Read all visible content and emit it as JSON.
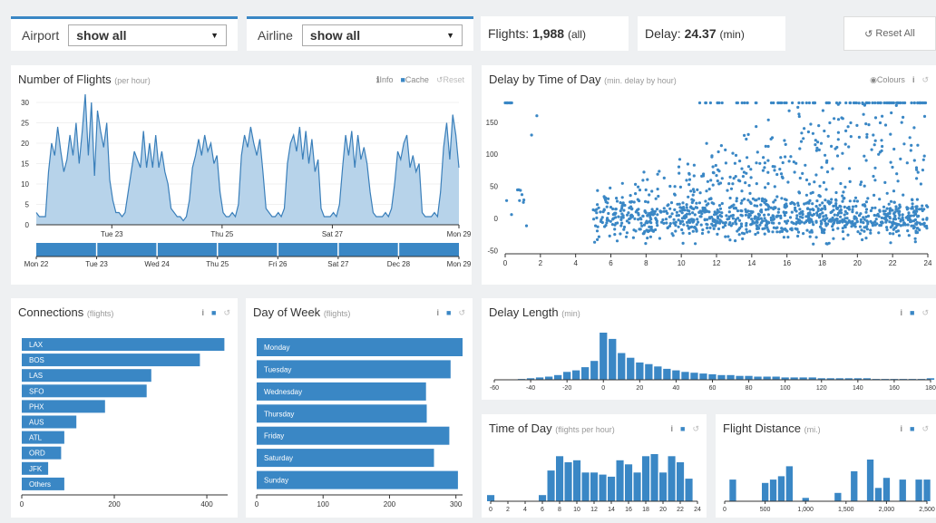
{
  "filters": {
    "airport": {
      "label": "Airport",
      "value": "show all"
    },
    "airline": {
      "label": "Airline",
      "value": "show all"
    }
  },
  "stats": {
    "flights_label": "Flights:",
    "flights_value": "1,988",
    "flights_unit": "(all)",
    "delay_label": "Delay:",
    "delay_value": "24.37",
    "delay_unit": "(min)",
    "reset_all": "Reset All"
  },
  "tools": {
    "info": "Info",
    "cache": "Cache",
    "reset": "Reset",
    "colours": "Colours",
    "i": "i"
  },
  "icons": {
    "info": "info-icon",
    "bookmark": "bookmark-icon",
    "reset": "reset-icon",
    "eye": "eye-icon",
    "caret": "caret-down-icon"
  },
  "colors": {
    "bar": "#3a87c5",
    "area_fill": "#b7d3ea",
    "line": "#3a7fba",
    "accent": "#3a87c5",
    "background": "#eef0f2"
  },
  "panels": {
    "flights_per_hour": {
      "title": "Number of Flights",
      "subtitle": "(per hour)"
    },
    "delay_by_time": {
      "title": "Delay by Time of Day",
      "subtitle": "(min. delay by hour)"
    },
    "connections": {
      "title": "Connections",
      "subtitle": "(flights)"
    },
    "day_of_week": {
      "title": "Day of Week",
      "subtitle": "(flights)"
    },
    "delay_length": {
      "title": "Delay Length",
      "subtitle": "(min)"
    },
    "time_of_day": {
      "title": "Time of Day",
      "subtitle": "(flights per hour)"
    },
    "distance": {
      "title": "Flight Distance",
      "subtitle": "(mi.)"
    }
  },
  "chart_data": [
    {
      "id": "flights_per_hour",
      "type": "area",
      "x": [
        0,
        3,
        6,
        9,
        12,
        15,
        18,
        21,
        24,
        27,
        30,
        33,
        36,
        39,
        42,
        45,
        48,
        51,
        54,
        57,
        60,
        63,
        66,
        69,
        72,
        75,
        78,
        81,
        84,
        87,
        90,
        93,
        96,
        99,
        102,
        105,
        108,
        111,
        114,
        117,
        120,
        123,
        126,
        129,
        132,
        135,
        138,
        141,
        144,
        147,
        150,
        153,
        156,
        159,
        162,
        165,
        168,
        171,
        174,
        177,
        180,
        183,
        186,
        189,
        192,
        195,
        198,
        201,
        204,
        207,
        210,
        213,
        216,
        219,
        222,
        225,
        228,
        231,
        234,
        237,
        240,
        243,
        246,
        249,
        252,
        255,
        258,
        261,
        264,
        267,
        270,
        273,
        276,
        279,
        282,
        285,
        288,
        291,
        294,
        297,
        300,
        303,
        306,
        309,
        312,
        315,
        318,
        321,
        324,
        327,
        330,
        333,
        336,
        339,
        342,
        345,
        348,
        351,
        354,
        357,
        360,
        363,
        366,
        369,
        372,
        375,
        378,
        381,
        384,
        387,
        390,
        393,
        396,
        399,
        402,
        405,
        408,
        411,
        414
      ],
      "values": [
        3,
        2,
        2,
        2,
        13,
        20,
        17,
        24,
        18,
        13,
        16,
        22,
        17,
        25,
        15,
        23,
        32,
        17,
        30,
        12,
        28,
        23,
        19,
        25,
        11,
        6,
        3,
        3,
        2,
        3,
        8,
        13,
        18,
        16,
        14,
        23,
        14,
        20,
        14,
        22,
        14,
        18,
        13,
        10,
        4,
        3,
        2,
        2,
        1,
        2,
        6,
        14,
        17,
        21,
        17,
        22,
        18,
        20,
        15,
        17,
        8,
        3,
        2,
        2,
        3,
        2,
        5,
        17,
        22,
        19,
        24,
        20,
        17,
        21,
        13,
        4,
        3,
        2,
        2,
        3,
        2,
        4,
        15,
        20,
        22,
        18,
        24,
        16,
        23,
        15,
        21,
        13,
        16,
        4,
        2,
        2,
        2,
        3,
        2,
        5,
        14,
        22,
        17,
        23,
        14,
        22,
        16,
        19,
        15,
        8,
        3,
        2,
        2,
        2,
        3,
        2,
        4,
        10,
        18,
        16,
        20,
        22,
        14,
        17,
        13,
        15,
        3,
        2,
        2,
        2,
        3,
        2,
        8,
        19,
        25,
        16,
        27,
        22,
        14,
        20
      ],
      "ylim": [
        0,
        32
      ],
      "yticks": [
        0,
        5,
        10,
        15,
        20,
        25,
        30
      ],
      "xticks": [
        {
          "x": 74,
          "label": "Tue 23"
        },
        {
          "x": 182,
          "label": "Thu 25"
        },
        {
          "x": 290,
          "label": "Sat 27"
        },
        {
          "x": 414,
          "label": "Mon 29"
        }
      ],
      "brush_ticks": [
        "Mon 22",
        "Tue 23",
        "Wed 24",
        "Thu 25",
        "Fri 26",
        "Sat 27",
        "Dec 28",
        "Mon 29"
      ]
    },
    {
      "id": "delay_by_time",
      "type": "scatter",
      "xlim": [
        0,
        24
      ],
      "ylim": [
        -55,
        185
      ],
      "xticks": [
        0,
        2,
        4,
        6,
        8,
        10,
        12,
        14,
        16,
        18,
        20,
        22,
        24
      ],
      "yticks": [
        -50,
        0,
        50,
        100,
        150
      ],
      "points": []
    },
    {
      "id": "connections",
      "type": "bar",
      "orientation": "horizontal",
      "categories": [
        "LAX",
        "BOS",
        "LAS",
        "SFO",
        "PHX",
        "AUS",
        "ATL",
        "ORD",
        "JFK",
        "Others"
      ],
      "values": [
        438,
        385,
        280,
        270,
        180,
        118,
        92,
        85,
        57,
        92
      ],
      "xlim": [
        0,
        445
      ],
      "xticks": [
        0,
        200,
        400
      ]
    },
    {
      "id": "day_of_week",
      "type": "bar",
      "orientation": "horizontal",
      "categories": [
        "Monday",
        "Tuesday",
        "Wednesday",
        "Thursday",
        "Friday",
        "Saturday",
        "Sunday"
      ],
      "values": [
        310,
        292,
        255,
        256,
        290,
        267,
        303
      ],
      "xlim": [
        0,
        310
      ],
      "xticks": [
        0,
        100,
        200,
        300
      ]
    },
    {
      "id": "delay_length",
      "type": "bar",
      "x": [
        -60,
        -55,
        -50,
        -45,
        -40,
        -35,
        -30,
        -25,
        -20,
        -15,
        -10,
        -5,
        0,
        5,
        10,
        15,
        20,
        25,
        30,
        35,
        40,
        45,
        50,
        55,
        60,
        65,
        70,
        75,
        80,
        85,
        90,
        95,
        100,
        105,
        110,
        115,
        120,
        125,
        130,
        135,
        140,
        145,
        150,
        155,
        160,
        165,
        170,
        175,
        180
      ],
      "values": [
        0,
        0,
        0,
        1,
        2,
        3,
        4,
        6,
        10,
        12,
        16,
        24,
        60,
        52,
        34,
        28,
        22,
        20,
        17,
        14,
        12,
        10,
        9,
        8,
        7,
        6,
        6,
        5,
        5,
        4,
        4,
        4,
        3,
        3,
        3,
        3,
        2,
        2,
        2,
        2,
        2,
        2,
        1,
        1,
        1,
        1,
        1,
        1,
        2
      ],
      "xlim": [
        -60,
        180
      ],
      "xticks": [
        -60,
        -40,
        -20,
        0,
        20,
        40,
        60,
        80,
        100,
        120,
        140,
        160,
        180
      ]
    },
    {
      "id": "time_of_day",
      "type": "bar",
      "x": [
        0,
        1,
        2,
        3,
        4,
        5,
        6,
        7,
        8,
        9,
        10,
        11,
        12,
        13,
        14,
        15,
        16,
        17,
        18,
        19,
        20,
        21,
        22,
        23
      ],
      "values": [
        3,
        0,
        0,
        0,
        0,
        0,
        3,
        15,
        22,
        19,
        20,
        14,
        14,
        13,
        12,
        20,
        18,
        14,
        22,
        23,
        14,
        22,
        19,
        11
      ],
      "xlim": [
        0,
        24
      ],
      "xticks": [
        0,
        2,
        4,
        6,
        8,
        10,
        12,
        14,
        16,
        18,
        20,
        22,
        24
      ]
    },
    {
      "id": "distance",
      "type": "bar",
      "x": [
        0,
        100,
        200,
        300,
        400,
        500,
        600,
        700,
        800,
        900,
        1000,
        1100,
        1200,
        1300,
        1400,
        1500,
        1600,
        1700,
        1800,
        1900,
        2000,
        2100,
        2200,
        2300,
        2400,
        2500
      ],
      "values": [
        0,
        13,
        0,
        0,
        0,
        11,
        13,
        15,
        21,
        0,
        2,
        0,
        0,
        0,
        5,
        0,
        18,
        0,
        25,
        8,
        14,
        0,
        13,
        0,
        13,
        13
      ],
      "xlim": [
        0,
        2500
      ],
      "xticks": [
        {
          "v": 0,
          "label": "0"
        },
        {
          "v": 500,
          "label": "500"
        },
        {
          "v": 1000,
          "label": "1,000"
        },
        {
          "v": 1500,
          "label": "1,500"
        },
        {
          "v": 2000,
          "label": "2,000"
        },
        {
          "v": 2500,
          "label": "2,500"
        }
      ]
    }
  ]
}
